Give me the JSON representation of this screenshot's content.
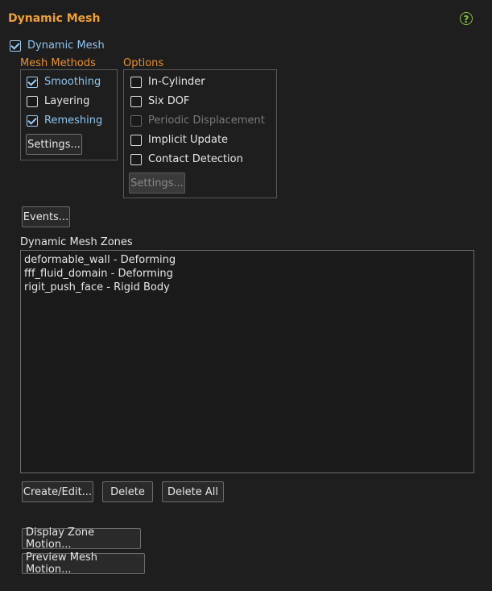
{
  "panel": {
    "title": "Dynamic Mesh",
    "help_icon": "help-icon",
    "help_glyph": "?"
  },
  "dynamic_mesh": {
    "label": "Dynamic Mesh",
    "checked": true
  },
  "mesh_methods": {
    "title": "Mesh Methods",
    "items": [
      {
        "label": "Smoothing",
        "checked": true
      },
      {
        "label": "Layering",
        "checked": false
      },
      {
        "label": "Remeshing",
        "checked": true
      }
    ],
    "settings_label": "Settings..."
  },
  "options": {
    "title": "Options",
    "items": [
      {
        "label": "In-Cylinder",
        "checked": false,
        "enabled": true
      },
      {
        "label": "Six DOF",
        "checked": false,
        "enabled": true
      },
      {
        "label": "Periodic Displacement",
        "checked": false,
        "enabled": false
      },
      {
        "label": "Implicit Update",
        "checked": false,
        "enabled": true
      },
      {
        "label": "Contact Detection",
        "checked": false,
        "enabled": true
      }
    ],
    "settings_label": "Settings..."
  },
  "events_label": "Events...",
  "zones": {
    "title": "Dynamic Mesh Zones",
    "items": [
      "deformable_wall - Deforming",
      "fff_fluid_domain - Deforming",
      "rigit_push_face - Rigid Body"
    ]
  },
  "zone_buttons": {
    "create_edit": "Create/Edit...",
    "delete": "Delete",
    "delete_all": "Delete All"
  },
  "motion_buttons": {
    "display_zone_motion": "Display Zone Motion...",
    "preview_mesh_motion": "Preview Mesh Motion..."
  },
  "colors": {
    "accent": "#f0a030",
    "check_blue": "#9ecbf2",
    "help_green": "#8bc34a"
  }
}
